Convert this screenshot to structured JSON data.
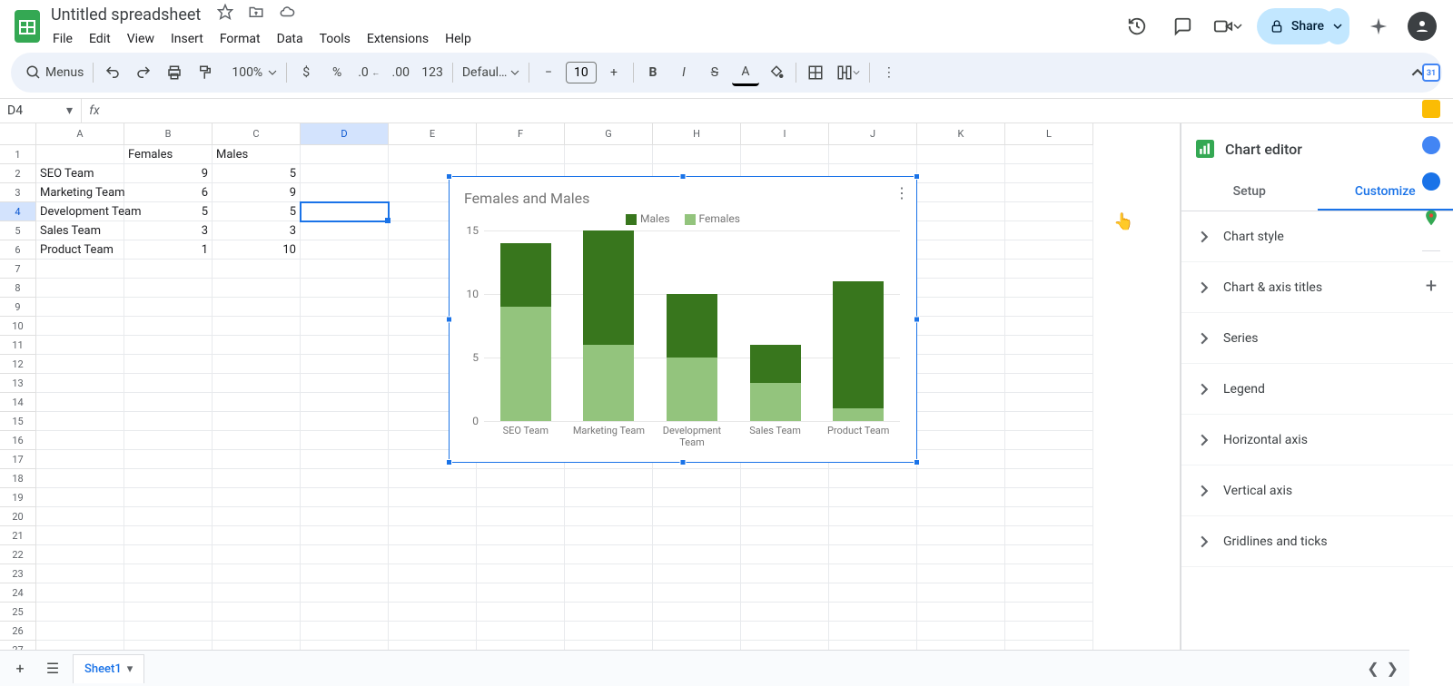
{
  "doc": {
    "title": "Untitled spreadsheet"
  },
  "menu": [
    "File",
    "Edit",
    "View",
    "Insert",
    "Format",
    "Data",
    "Tools",
    "Extensions",
    "Help"
  ],
  "toolbar": {
    "search_label": "Menus",
    "zoom": "100%",
    "font": "Defaul…",
    "font_size": "10"
  },
  "header": {
    "share": "Share"
  },
  "name_box": "D4",
  "columns": [
    "A",
    "B",
    "C",
    "D",
    "E",
    "F",
    "G",
    "H",
    "I",
    "J",
    "K",
    "L"
  ],
  "selected_col_index": 3,
  "selected_row_index": 3,
  "grid_data": {
    "headers": [
      "",
      "Females",
      "Males"
    ],
    "rows": [
      {
        "label": "SEO Team",
        "females": 9,
        "males": 5
      },
      {
        "label": "Marketing Team",
        "females": 6,
        "males": 9
      },
      {
        "label": "Development Team",
        "females": 5,
        "males": 5
      },
      {
        "label": "Sales Team",
        "females": 3,
        "males": 3
      },
      {
        "label": "Product Team",
        "females": 1,
        "males": 10
      }
    ]
  },
  "chart_data": {
    "type": "bar",
    "stacked": true,
    "title": "Females and Males",
    "categories": [
      "SEO Team",
      "Marketing Team",
      "Development Team",
      "Sales Team",
      "Product Team"
    ],
    "series": [
      {
        "name": "Males",
        "values": [
          5,
          9,
          5,
          3,
          10
        ],
        "color": "#38761d"
      },
      {
        "name": "Females",
        "values": [
          9,
          6,
          5,
          3,
          1
        ],
        "color": "#93c47d"
      }
    ],
    "ylim": [
      0,
      15
    ],
    "yticks": [
      0,
      5,
      10,
      15
    ],
    "legend_position": "top",
    "xlabel": "",
    "ylabel": ""
  },
  "editor": {
    "title": "Chart editor",
    "tabs": [
      "Setup",
      "Customize"
    ],
    "active_tab": "Customize",
    "sections": [
      "Chart style",
      "Chart & axis titles",
      "Series",
      "Legend",
      "Horizontal axis",
      "Vertical axis",
      "Gridlines and ticks"
    ]
  },
  "sheet_tabs": {
    "active": "Sheet1"
  }
}
